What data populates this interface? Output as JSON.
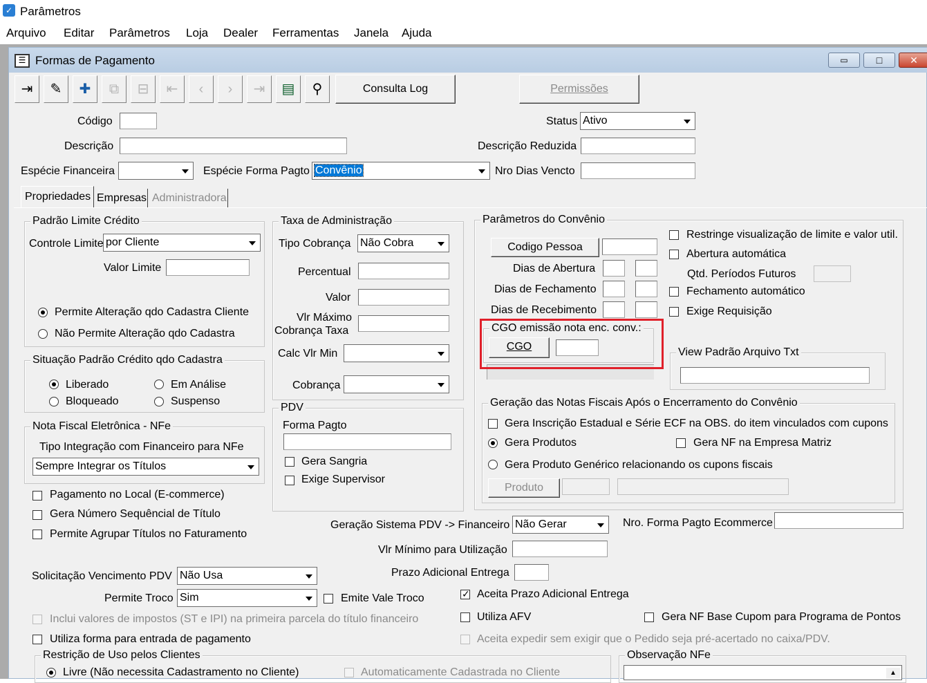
{
  "app": {
    "title": "Parâmetros"
  },
  "menu": [
    "Arquivo",
    "Editar",
    "Parâmetros",
    "Loja",
    "Dealer",
    "Ferramentas",
    "Janela",
    "Ajuda"
  ],
  "window": {
    "title": "Formas de Pagamento",
    "min": "▭",
    "max": "□",
    "close": "✕"
  },
  "toolbar": {
    "icons": [
      "exit-icon",
      "edit-icon",
      "add-icon",
      "copy-icon",
      "delete-icon",
      "first-icon",
      "prev-icon",
      "next-icon",
      "last-icon",
      "list-icon",
      "search-icon"
    ],
    "consulta_log": "Consulta Log",
    "permissoes": "Permissões"
  },
  "header": {
    "codigo_label": "Código",
    "codigo_value": "",
    "status_label": "Status",
    "status_value": "Ativo",
    "descricao_label": "Descrição",
    "descricao_value": "",
    "descricao_reduzida_label": "Descrição Reduzida",
    "descricao_reduzida_value": "",
    "especie_financeira_label": "Espécie Financeira",
    "especie_financeira_value": "",
    "especie_forma_label": "Espécie Forma Pagto",
    "especie_forma_value": "Convênio",
    "nro_dias_label": "Nro Dias Vencto",
    "nro_dias_value": ""
  },
  "tabs": [
    "Propriedades",
    "Empresas",
    "Administradora"
  ],
  "padrao_limite": {
    "title": "Padrão Limite Crédito",
    "controle_label": "Controle Limite",
    "controle_value": "por Cliente",
    "valor_label": "Valor Limite",
    "valor_value": "",
    "radio1": "Permite Alteração qdo Cadastra Cliente",
    "radio2": "Não Permite Alteração qdo Cadastra"
  },
  "situacao": {
    "title": "Situação Padrão Crédito qdo Cadastra",
    "liberado": "Liberado",
    "em_analise": "Em Análise",
    "bloqueado": "Bloqueado",
    "suspenso": "Suspenso"
  },
  "nfe": {
    "title": "Nota Fiscal Eletrônica - NFe",
    "tipo_label": "Tipo Integração com Financeiro para NFe",
    "tipo_value": "Sempre Integrar os Títulos"
  },
  "left_checks": {
    "pagamento_local": "Pagamento no Local (E-commerce)",
    "gera_numero": "Gera Número Sequêncial de Título",
    "permite_agrupar": "Permite Agrupar Títulos no Faturamento"
  },
  "taxa": {
    "title": "Taxa de Administração",
    "tipo_label": "Tipo Cobrança",
    "tipo_value": "Não Cobra",
    "percentual": "Percentual",
    "valor": "Valor",
    "vlr_max_1": "Vlr Máximo",
    "vlr_max_2": "Cobrança Taxa",
    "calc_min": "Calc Vlr Min",
    "cobranca": "Cobrança"
  },
  "pdv": {
    "title": "PDV",
    "forma_label": "Forma Pagto",
    "gera_sangria": "Gera Sangria",
    "exige_supervisor": "Exige Supervisor"
  },
  "convenio": {
    "title": "Parâmetros do Convênio",
    "codigo_pessoa": "Codigo Pessoa",
    "dias_abertura": "Dias de Abertura",
    "dias_fechamento": "Dias de Fechamento",
    "dias_recebimento": "Dias de Recebimento",
    "restringe": "Restringe visualização de limite e valor util.",
    "abertura_auto": "Abertura automática",
    "qtd_periodos": "Qtd. Períodos Futuros",
    "fechamento_auto": "Fechamento automático",
    "exige_req": "Exige Requisição",
    "cgo_group": "CGO emissão nota enc. conv.:",
    "cgo_button": "CGO",
    "view_padrao": "View Padrão Arquivo Txt"
  },
  "geracao_nf": {
    "title": "Geração das Notas Fiscais Após o Encerramento do Convênio",
    "gera_inscricao": "Gera Inscrição Estadual e Série ECF na OBS. do item vinculados com cupons",
    "gera_produtos": "Gera Produtos",
    "gera_nf_matriz": "Gera NF na Empresa Matriz",
    "gera_generico": "Gera Produto Genérico relacionando os cupons fiscais",
    "produto_button": "Produto"
  },
  "bottom": {
    "geracao_pdv_label": "Geração Sistema PDV -> Financeiro",
    "geracao_pdv_value": "Não Gerar",
    "nro_ecommerce_label": "Nro. Forma Pagto Ecommerce",
    "vlr_minimo_label": "Vlr Mínimo para Utilização",
    "prazo_label": "Prazo Adicional Entrega",
    "solicitacao_label": "Solicitação Vencimento PDV",
    "solicitacao_value": "Não Usa",
    "permite_troco_label": "Permite Troco",
    "permite_troco_value": "Sim",
    "emite_vale": "Emite Vale Troco",
    "aceita_prazo": "Aceita Prazo Adicional Entrega",
    "utiliza_afv": "Utiliza AFV",
    "gera_nf_cupom": "Gera NF Base Cupom para Programa de Pontos",
    "inclui_valores": "Inclui valores de impostos (ST e IPI) na primeira parcela do título financeiro",
    "aceita_expedir": "Aceita expedir sem exigir que o Pedido seja pré-acertado no caixa/PDV.",
    "utiliza_forma": "Utiliza forma para entrada de pagamento",
    "restricao_title": "Restrição de Uso pelos Clientes",
    "livre": "Livre (Não necessita Cadastramento no Cliente)",
    "automaticamente": "Automaticamente Cadastrada no Cliente",
    "observacao_title": "Observação NFe"
  }
}
